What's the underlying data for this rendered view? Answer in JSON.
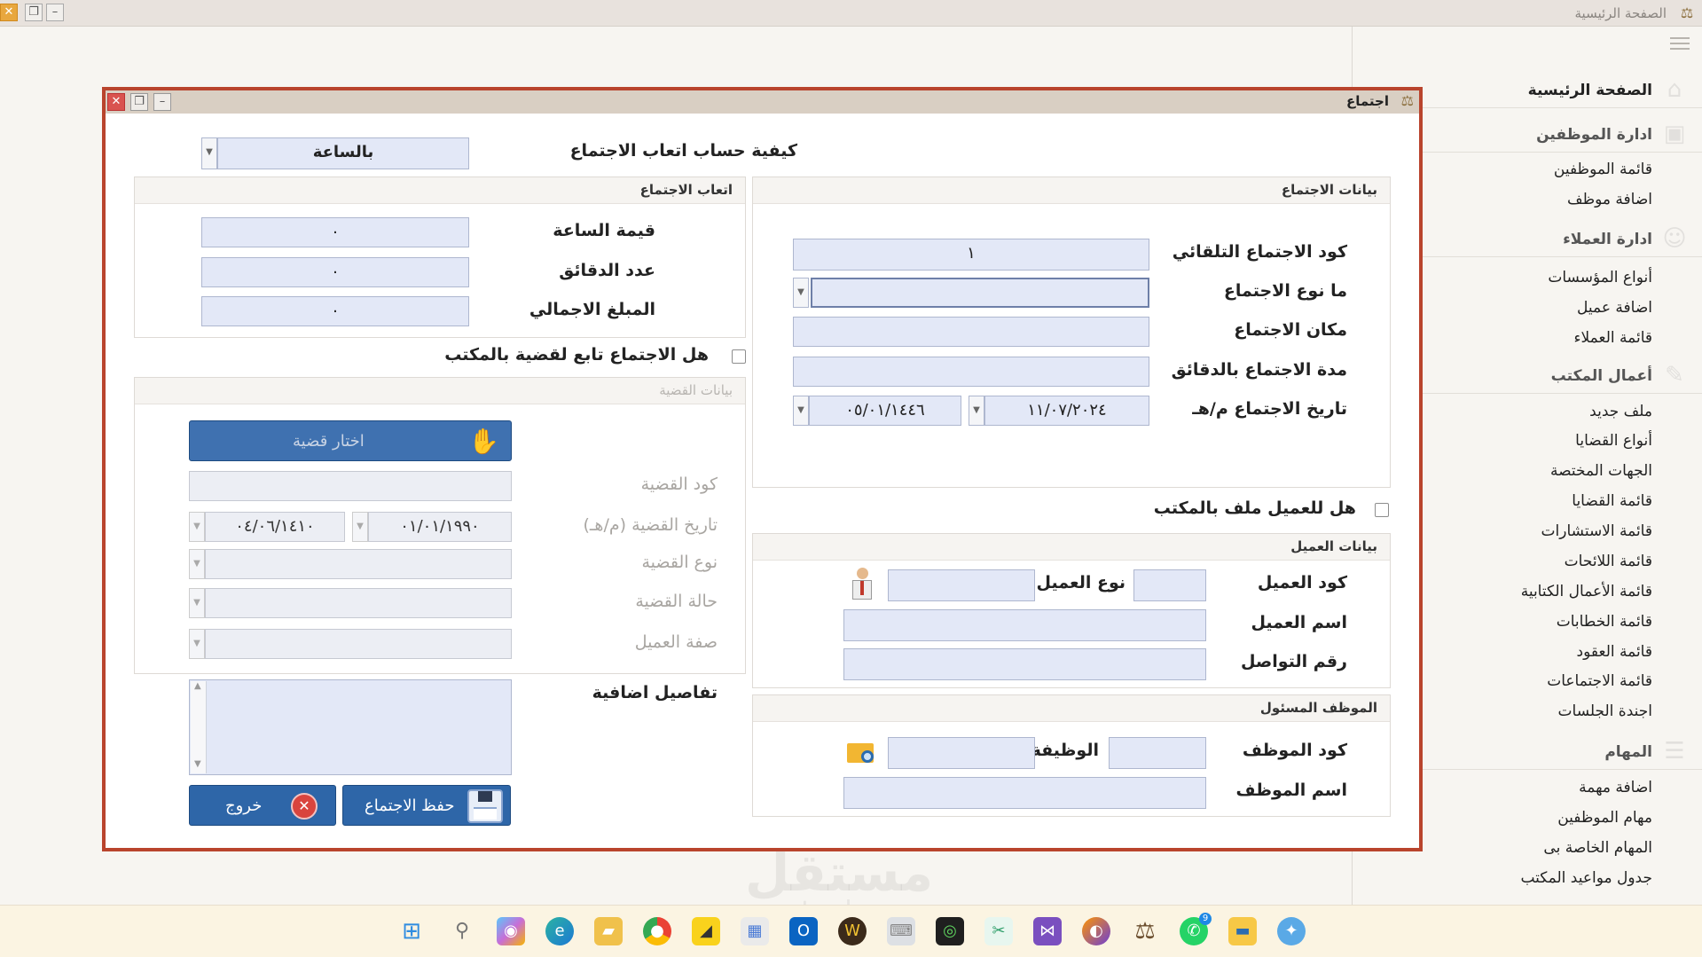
{
  "window": {
    "title": "الصفحة الرئيسية",
    "controls": [
      "close",
      "maximize",
      "minimize"
    ]
  },
  "sidebar": {
    "sections": [
      {
        "label": "الصفحة الرئيسية",
        "icon": "home-icon"
      },
      {
        "label": "ادارة الموظفين",
        "icon": "employees-icon",
        "items": [
          "قائمة الموظفين",
          "اضافة موظف"
        ]
      },
      {
        "label": "ادارة العملاء",
        "icon": "clients-icon",
        "items": [
          "أنواع المؤسسات",
          "اضافة عميل",
          "قائمة العملاء"
        ]
      },
      {
        "label": "أعمال المكتب",
        "icon": "office-work-icon",
        "items": [
          "ملف جديد",
          "أنواع القضايا",
          "الجهات المختصة",
          "قائمة القضايا",
          "قائمة الاستشارات",
          "قائمة اللائحات",
          "قائمة الأعمال الكتابية",
          "قائمة الخطابات",
          "قائمة العقود",
          "قائمة الاجتماعات",
          "اجندة الجلسات"
        ]
      },
      {
        "label": "المهام",
        "icon": "tasks-icon",
        "items": [
          "اضافة مهمة",
          "مهام الموظفين",
          "المهام الخاصة بى",
          "جدول مواعيد المكتب"
        ]
      }
    ]
  },
  "dialog": {
    "title": "اجتماع",
    "fee_method": {
      "label": "كيفية حساب اتعاب الاجتماع",
      "value": "بالساعة"
    },
    "fees_group": {
      "title": "اتعاب الاجتماع",
      "hour_value": {
        "label": "قيمة الساعة",
        "value": "٠"
      },
      "minutes_count": {
        "label": "عدد الدقائق",
        "value": "٠"
      },
      "total_amount": {
        "label": "المبلغ الاجمالي",
        "value": "٠"
      }
    },
    "case_linked_checkbox": {
      "label": "هل الاجتماع تابع لقضية بالمكتب",
      "checked": false
    },
    "case_group": {
      "title": "بيانات القضية",
      "choose_case_button": "اختار قضية",
      "case_code": {
        "label": "كود القضية",
        "value": ""
      },
      "case_date": {
        "label": "تاريخ القضية (م/هـ)",
        "gregorian": "٠١/٠١/١٩٩٠",
        "hijri": "٠٤/٠٦/١٤١٠"
      },
      "case_type": {
        "label": "نوع القضية",
        "value": ""
      },
      "case_status": {
        "label": "حالة القضية",
        "value": ""
      },
      "client_role": {
        "label": "صفة العميل",
        "value": ""
      }
    },
    "extra_details": {
      "label": "تفاصيل اضافية",
      "value": ""
    },
    "buttons": {
      "save": "حفظ الاجتماع",
      "exit": "خروج"
    },
    "meeting_group": {
      "title": "بيانات الاجتماع",
      "auto_code": {
        "label": "كود الاجتماع التلقائي",
        "value": "١"
      },
      "meeting_type": {
        "label": "ما نوع الاجتماع",
        "value": ""
      },
      "meeting_place": {
        "label": "مكان الاجتماع",
        "value": ""
      },
      "duration_minutes": {
        "label": "مدة الاجتماع بالدقائق",
        "value": ""
      },
      "meeting_date": {
        "label": "تاريخ الاجتماع م/هـ",
        "gregorian": "١١/٠٧/٢٠٢٤",
        "hijri": "٠٥/٠١/١٤٤٦"
      }
    },
    "client_file_checkbox": {
      "label": "هل للعميل ملف بالمكتب",
      "checked": false
    },
    "client_group": {
      "title": "بيانات العميل",
      "client_code": {
        "label": "كود العميل",
        "value": ""
      },
      "client_type": {
        "label": "نوع العميل",
        "value": ""
      },
      "client_name": {
        "label": "اسم العميل",
        "value": ""
      },
      "contact_number": {
        "label": "رقم التواصل",
        "value": ""
      }
    },
    "employee_group": {
      "title": "الموظف المسئول",
      "employee_code": {
        "label": "كود الموظف",
        "value": ""
      },
      "job": {
        "label": "الوظيفة",
        "value": ""
      },
      "employee_name": {
        "label": "اسم الموظف",
        "value": ""
      }
    }
  },
  "taskbar": {
    "icons": [
      "windows-start-icon",
      "search-icon",
      "copilot-icon",
      "edge-icon",
      "files-icon",
      "chrome-icon",
      "sticky-notes-icon",
      "store-icon",
      "outlook-icon",
      "app-w-icon",
      "keyboard-icon",
      "terminal-icon",
      "snipping-tool-icon",
      "visual-studio-icon",
      "firefox-icon",
      "justice-app-icon",
      "whatsapp-icon",
      "file-explorer-icon",
      "network-icon"
    ],
    "whatsapp_badge": "9"
  },
  "watermark": {
    "arabic": "مستقل",
    "latin": "mostaql.com"
  }
}
